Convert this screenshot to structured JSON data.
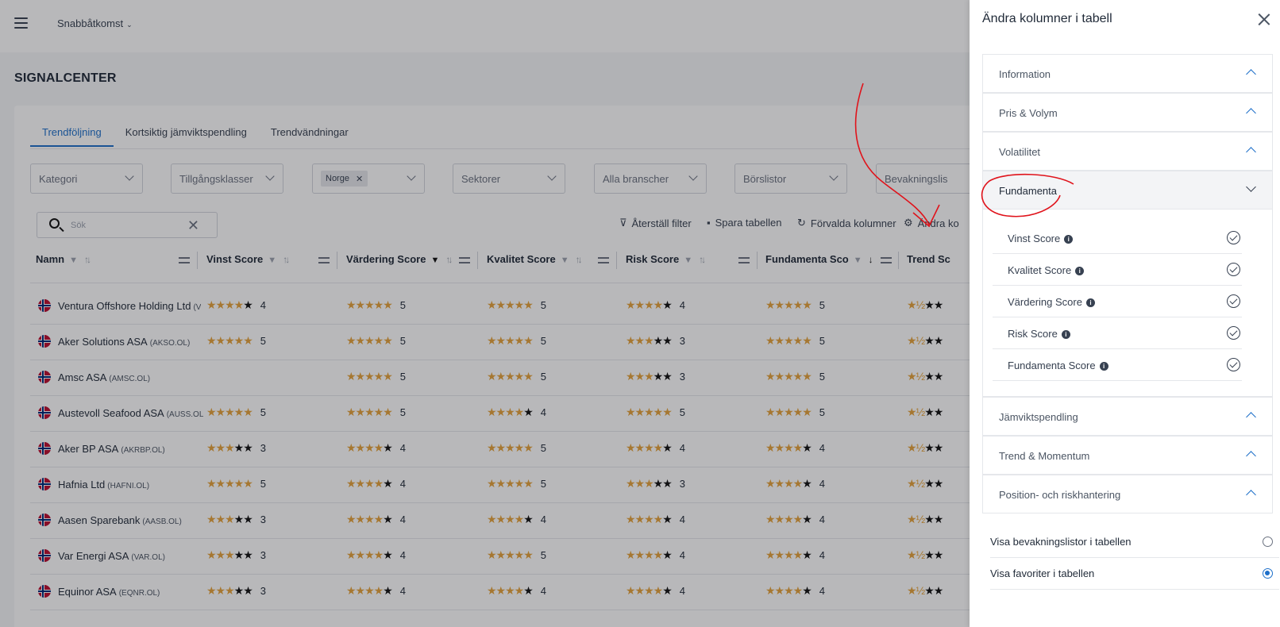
{
  "app": {
    "workspace": "Snabbåtkomst",
    "page_title": "SIGNALCENTER"
  },
  "tabs": [
    "Trendföljning",
    "Kortsiktig jämviktspendling",
    "Trendvändningar"
  ],
  "filters": {
    "kategori": "Kategori",
    "tillgangsklasser": "Tillgångsklasser",
    "norge_chip": "Norge",
    "sektorer": "Sektorer",
    "branscher": "Alla branscher",
    "borslistor": "Börslistor",
    "bevakningslistor": "Bevakningslis"
  },
  "search": {
    "placeholder": "Sök"
  },
  "toolbar": {
    "reset": "Återställ filter",
    "save": "Spara tabellen",
    "defaults": "Förvalda kolumner",
    "edit": "Ändra ko"
  },
  "columns": {
    "namn": "Namn",
    "vinst": "Vinst Score",
    "vardering": "Värdering Score",
    "kvalitet": "Kvalitet Score",
    "risk": "Risk Score",
    "fundamenta": "Fundamenta Sco",
    "trend": "Trend Sc"
  },
  "rows": [
    {
      "name": "Ventura Offshore Holding Ltd",
      "ticker": "(V",
      "vinst": "4",
      "vardering": "5",
      "kvalitet": "5",
      "risk": "4",
      "fundamenta": "5"
    },
    {
      "name": "Aker Solutions ASA",
      "ticker": "(AKSO.OL)",
      "vinst": "5",
      "vardering": "5",
      "kvalitet": "5",
      "risk": "3",
      "fundamenta": "5"
    },
    {
      "name": "Amsc ASA",
      "ticker": "(AMSC.OL)",
      "vinst": "",
      "vardering": "5",
      "kvalitet": "5",
      "risk": "3",
      "fundamenta": "5"
    },
    {
      "name": "Austevoll Seafood ASA",
      "ticker": "(AUSS.OL",
      "vinst": "5",
      "vardering": "5",
      "kvalitet": "4",
      "risk": "5",
      "fundamenta": "5"
    },
    {
      "name": "Aker BP ASA",
      "ticker": "(AKRBP.OL)",
      "vinst": "3",
      "vardering": "4",
      "kvalitet": "5",
      "risk": "4",
      "fundamenta": "4"
    },
    {
      "name": "Hafnia Ltd",
      "ticker": "(HAFNI.OL)",
      "vinst": "5",
      "vardering": "4",
      "kvalitet": "5",
      "risk": "3",
      "fundamenta": "4"
    },
    {
      "name": "Aasen Sparebank",
      "ticker": "(AASB.OL)",
      "vinst": "3",
      "vardering": "4",
      "kvalitet": "4",
      "risk": "4",
      "fundamenta": "4"
    },
    {
      "name": "Var Energi ASA",
      "ticker": "(VAR.OL)",
      "vinst": "3",
      "vardering": "4",
      "kvalitet": "5",
      "risk": "4",
      "fundamenta": "4"
    },
    {
      "name": "Equinor ASA",
      "ticker": "(EQNR.OL)",
      "vinst": "3",
      "vardering": "4",
      "kvalitet": "4",
      "risk": "4",
      "fundamenta": "4"
    }
  ],
  "panel": {
    "title": "Ändra kolumner i tabell",
    "sections": {
      "information": "Information",
      "pris_volym": "Pris & Volym",
      "volatilitet": "Volatilitet",
      "fundamenta": "Fundamenta",
      "jamvikt": "Jämviktspendling",
      "trend": "Trend & Momentum",
      "position": "Position- och riskhantering"
    },
    "fundamenta_options": [
      "Vinst Score",
      "Kvalitet Score",
      "Värdering Score",
      "Risk Score",
      "Fundamenta Score"
    ],
    "toggles": {
      "watchlists": "Visa bevakningslistor i tabellen",
      "favorites": "Visa favoriter i tabellen"
    }
  },
  "colors": {
    "accent": "#1d6fc9",
    "star": "#e5a33b",
    "annotation": "#e0131b"
  }
}
